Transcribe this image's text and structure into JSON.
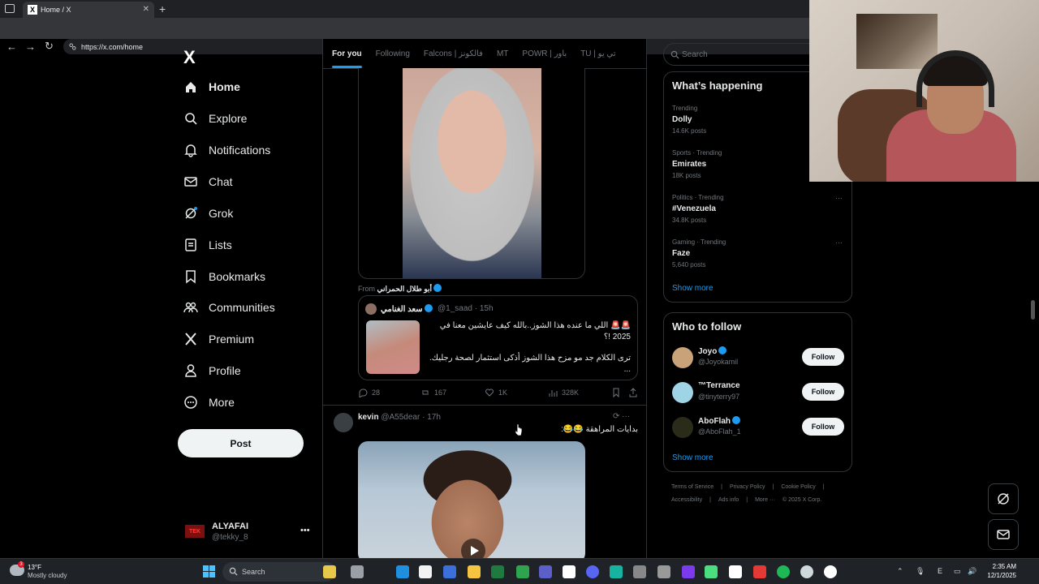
{
  "browser": {
    "tab_title": "Home / X",
    "tab_favicon": "X",
    "url": "https://x.com/home"
  },
  "nav": {
    "logo": "X",
    "items": [
      {
        "label": "Home",
        "icon": "home-icon"
      },
      {
        "label": "Explore",
        "icon": "search-icon"
      },
      {
        "label": "Notifications",
        "icon": "bell-icon"
      },
      {
        "label": "Chat",
        "icon": "mail-icon"
      },
      {
        "label": "Grok",
        "icon": "grok-icon"
      },
      {
        "label": "Lists",
        "icon": "list-icon"
      },
      {
        "label": "Bookmarks",
        "icon": "bookmark-icon"
      },
      {
        "label": "Communities",
        "icon": "communities-icon"
      },
      {
        "label": "Premium",
        "icon": "x-premium-icon"
      },
      {
        "label": "Profile",
        "icon": "person-icon"
      },
      {
        "label": "More",
        "icon": "more-circle-icon"
      }
    ],
    "post_label": "Post",
    "account": {
      "name": "ALYAFAI",
      "handle": "@tekky_8",
      "avatar_text": "TEK"
    }
  },
  "timeline": {
    "tabs": [
      "For you",
      "Following",
      "Falcons | فالكونز",
      "MT",
      "POWR | باور",
      "TU | تي يو"
    ],
    "tweet1": {
      "from_prefix": "From",
      "from_name": "أبو طلال الحمراني",
      "quote": {
        "name": "سعد الغنامي",
        "handle": "@1_saad · 15h",
        "text1": "🚨🚨 اللي ما عنده هذا الشوز..بالله كيف عايشين معنا في 2025 !؟",
        "text2": "ترى الكلام جد مو مزح هذا الشوز أذكى استثمار لصحة رجليك. ..."
      },
      "actions": {
        "replies": "28",
        "reposts": "167",
        "likes": "1K",
        "views": "328K"
      }
    },
    "tweet2": {
      "name": "kevin",
      "handle": "@A55dear · 17h",
      "text": "بدايات المراهقة 😂😂:"
    }
  },
  "sidebar": {
    "search_placeholder": "Search",
    "happening_title": "What’s happening",
    "trends": [
      {
        "context": "Trending",
        "name": "Dolly",
        "posts": "14.6K posts"
      },
      {
        "context": "Sports · Trending",
        "name": "Emirates",
        "posts": "18K posts"
      },
      {
        "context": "Politics · Trending",
        "name": "#Venezuela",
        "posts": "34.8K posts"
      },
      {
        "context": "Gaming · Trending",
        "name": "Faze",
        "posts": "5,640 posts"
      }
    ],
    "show_more": "Show more",
    "who_title": "Who to follow",
    "who": [
      {
        "name": "Joyo",
        "handle": "@Joyokamil",
        "button": "Follow"
      },
      {
        "name": "™Terrance",
        "handle": "@tinyterry97",
        "button": "Follow"
      },
      {
        "name": "AboFlah",
        "handle": "@AboFlah_1",
        "button": "Follow"
      }
    ],
    "footer1": [
      "Terms of Service",
      "|",
      "Privacy Policy",
      "|",
      "Cookie Policy",
      "|"
    ],
    "footer2": [
      "Accessibility",
      "|",
      "Ads info",
      "|",
      "More ···",
      "© 2025 X Corp."
    ]
  },
  "taskbar": {
    "temp": "13°F",
    "weather": "Mostly cloudy",
    "weather_badge": "3",
    "search": "Search",
    "time": "2:35 AM",
    "date": "12/1/2025",
    "lang": "E"
  },
  "colors": {
    "accent": "#1d9bf0",
    "bg": "#000000",
    "border": "#2f3336",
    "muted": "#71767b"
  }
}
